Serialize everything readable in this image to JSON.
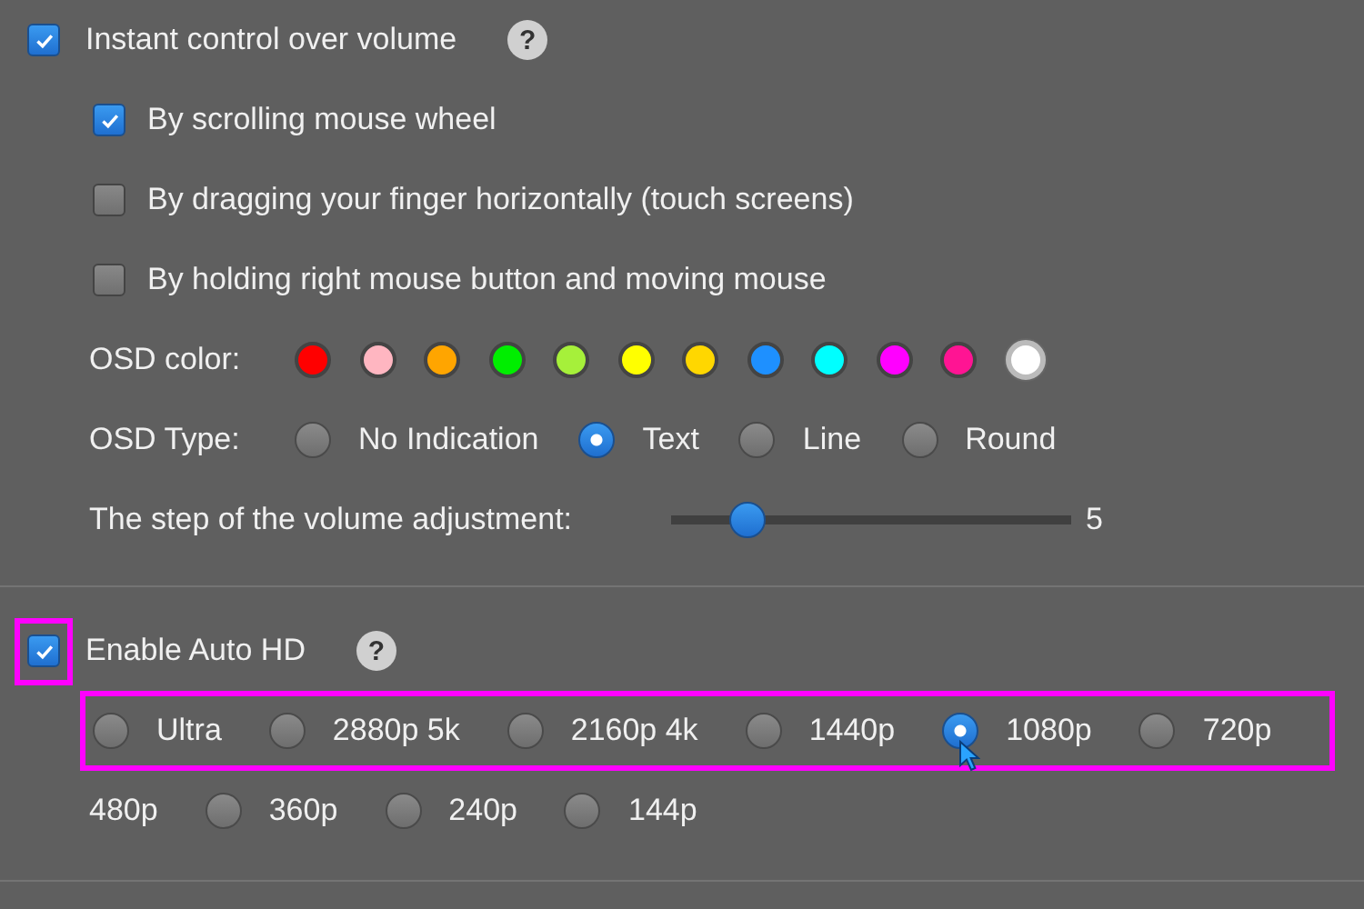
{
  "volume": {
    "label": "Instant control over volume",
    "checked": true,
    "help": "?",
    "options": [
      {
        "label": "By scrolling mouse wheel",
        "checked": true
      },
      {
        "label": "By dragging your finger horizontally (touch screens)",
        "checked": false
      },
      {
        "label": "By holding right mouse button and moving mouse",
        "checked": false
      }
    ],
    "osd_color": {
      "label": "OSD color:",
      "colors": [
        {
          "color": "#ff0000",
          "selected": false
        },
        {
          "color": "#ffb6c1",
          "selected": false
        },
        {
          "color": "#ffa500",
          "selected": false
        },
        {
          "color": "#00ee00",
          "selected": false
        },
        {
          "color": "#a6f03a",
          "selected": false
        },
        {
          "color": "#ffff00",
          "selected": false
        },
        {
          "color": "#ffd700",
          "selected": false
        },
        {
          "color": "#1e90ff",
          "selected": false
        },
        {
          "color": "#00ffff",
          "selected": false
        },
        {
          "color": "#ff00ff",
          "selected": false
        },
        {
          "color": "#ff1493",
          "selected": false
        },
        {
          "color": "#ffffff",
          "selected": true
        }
      ]
    },
    "osd_type": {
      "label": "OSD Type:",
      "options": [
        {
          "label": "No Indication",
          "selected": false
        },
        {
          "label": "Text",
          "selected": true
        },
        {
          "label": "Line",
          "selected": false
        },
        {
          "label": "Round",
          "selected": false
        }
      ]
    },
    "step": {
      "label": "The step of the volume adjustment:",
      "level": 0.19,
      "reading": "5"
    }
  },
  "auto_hd": {
    "label": "Enable Auto HD",
    "checked": true,
    "checkbox_highlighted": true,
    "help": "?",
    "rows": [
      {
        "highlighted": true,
        "items": [
          {
            "kind": "radio",
            "label": "Ultra",
            "selected": false,
            "hovered": false
          },
          {
            "kind": "radio",
            "label": "2880p 5k",
            "selected": false,
            "hovered": false
          },
          {
            "kind": "radio",
            "label": "2160p 4k",
            "selected": false,
            "hovered": false
          },
          {
            "kind": "radio",
            "label": "1440p",
            "selected": false,
            "hovered": false
          },
          {
            "kind": "radio",
            "label": "1080p",
            "selected": true,
            "hovered": true
          },
          {
            "kind": "radio",
            "label": "720p",
            "selected": false,
            "hovered": false
          }
        ]
      },
      {
        "highlighted": false,
        "items": [
          {
            "kind": "text",
            "label": "480p"
          },
          {
            "kind": "radio",
            "label": "360p",
            "selected": false,
            "hovered": false
          },
          {
            "kind": "radio",
            "label": "240p",
            "selected": false,
            "hovered": false
          },
          {
            "kind": "radio",
            "label": "144p",
            "selected": false,
            "hovered": false
          }
        ]
      }
    ]
  }
}
